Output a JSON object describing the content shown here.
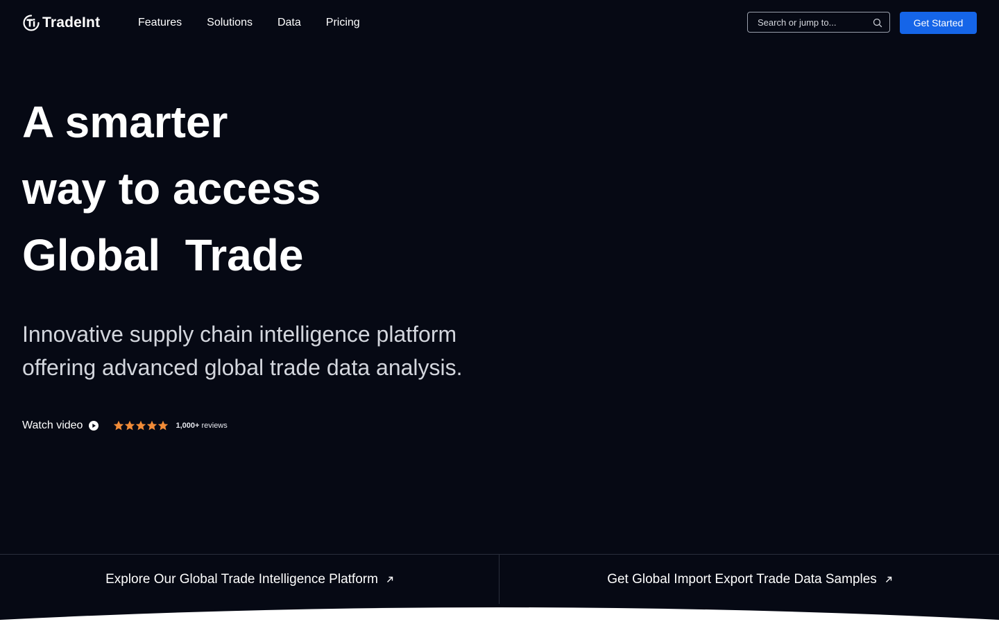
{
  "header": {
    "logo_text": "TradeInt",
    "logo_icon": "ti-logo-icon",
    "nav": [
      "Features",
      "Solutions",
      "Data",
      "Pricing"
    ],
    "search_placeholder": "Search or jump to...",
    "cta_label": "Get Started"
  },
  "hero": {
    "line1": "A smarter",
    "line2": "way to access",
    "line3": "Global  Trade",
    "subtitle": "Innovative supply chain intelligence platform offering advanced global trade data analysis.",
    "watch_label": "Watch video",
    "rating_stars": 5,
    "reviews_count": "1,000+",
    "reviews_label": "reviews"
  },
  "links": {
    "left": "Explore Our Global Trade Intelligence Platform",
    "right": "Get Global Import Export Trade Data Samples"
  },
  "colors": {
    "background": "#060914",
    "accent": "#1565e8",
    "star": "#f28c38"
  }
}
